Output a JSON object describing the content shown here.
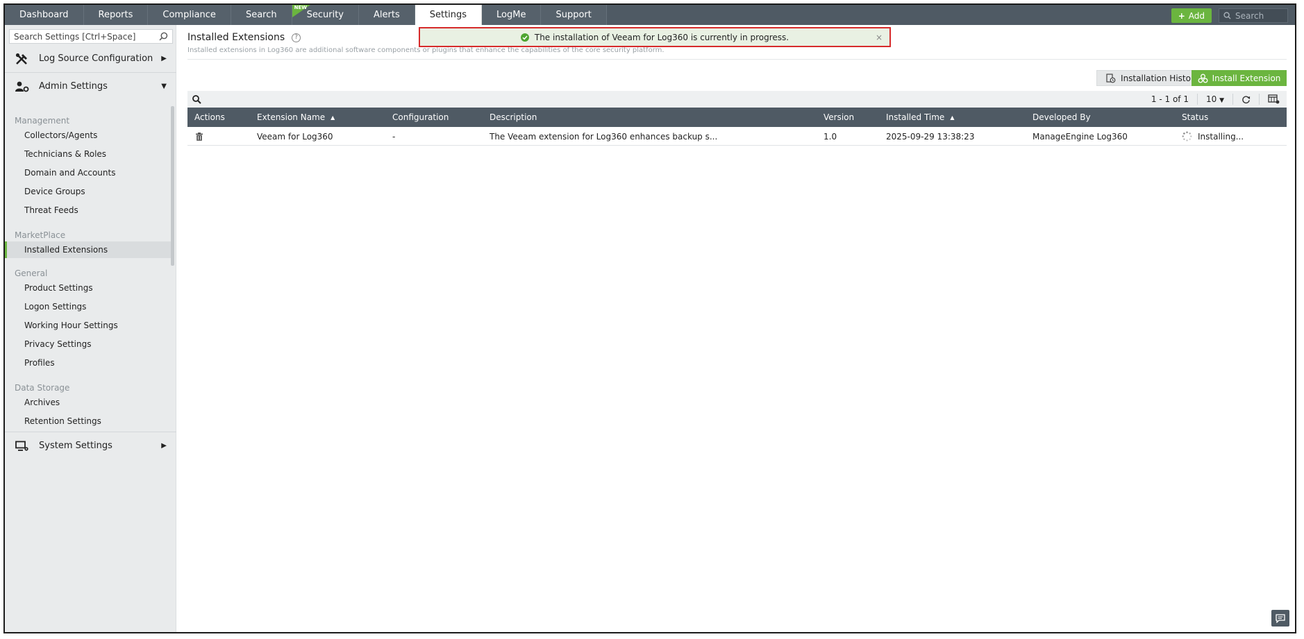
{
  "nav": {
    "tabs": [
      {
        "label": "Dashboard"
      },
      {
        "label": "Reports"
      },
      {
        "label": "Compliance"
      },
      {
        "label": "Search"
      },
      {
        "label": "Security",
        "badge": "NEW"
      },
      {
        "label": "Alerts"
      },
      {
        "label": "Settings",
        "active": true
      },
      {
        "label": "LogMe"
      },
      {
        "label": "Support"
      }
    ],
    "add_label": "Add",
    "search_placeholder": "Search"
  },
  "sidebar": {
    "search_placeholder": "Search Settings [Ctrl+Space]",
    "groups": {
      "log_source": "Log Source Configuration",
      "admin": "Admin Settings",
      "system": "System Settings"
    },
    "sections": {
      "management": "Management",
      "marketplace": "MarketPlace",
      "general": "General",
      "data_storage": "Data Storage"
    },
    "items": {
      "collectors": "Collectors/Agents",
      "technicians": "Technicians & Roles",
      "domain": "Domain and Accounts",
      "device_groups": "Device Groups",
      "threat_feeds": "Threat Feeds",
      "installed_extensions": "Installed Extensions",
      "product_settings": "Product Settings",
      "logon_settings": "Logon Settings",
      "working_hour": "Working Hour Settings",
      "privacy": "Privacy Settings",
      "profiles": "Profiles",
      "archives": "Archives",
      "retention": "Retention Settings"
    }
  },
  "main": {
    "title": "Installed Extensions",
    "help_glyph": "?",
    "description": "Installed extensions in Log360 are additional software components or plugins that enhance the capabilities of the core security platform.",
    "toast": "The installation of Veeam for Log360 is currently in progress.",
    "toast_close": "×",
    "history_button": "Installation History",
    "install_button": "Install Extension",
    "pager": {
      "range": "1 - 1 of 1",
      "per_page": "10"
    },
    "columns": {
      "actions": "Actions",
      "name": "Extension Name",
      "configuration": "Configuration",
      "description": "Description",
      "version": "Version",
      "installed_time": "Installed Time",
      "developed_by": "Developed By",
      "status": "Status"
    },
    "rows": [
      {
        "name": "Veeam for Log360",
        "configuration": "-",
        "description": "The Veeam extension for Log360 enhances backup s...",
        "version": "1.0",
        "installed_time": "2025-09-29 13:38:23",
        "developed_by": "ManageEngine Log360",
        "status": "Installing..."
      }
    ]
  },
  "colors": {
    "nav_bg": "#4f5a64",
    "accent_green": "#6bb53f",
    "toast_border": "#d62b2b",
    "toast_bg": "#e9f1e3"
  }
}
